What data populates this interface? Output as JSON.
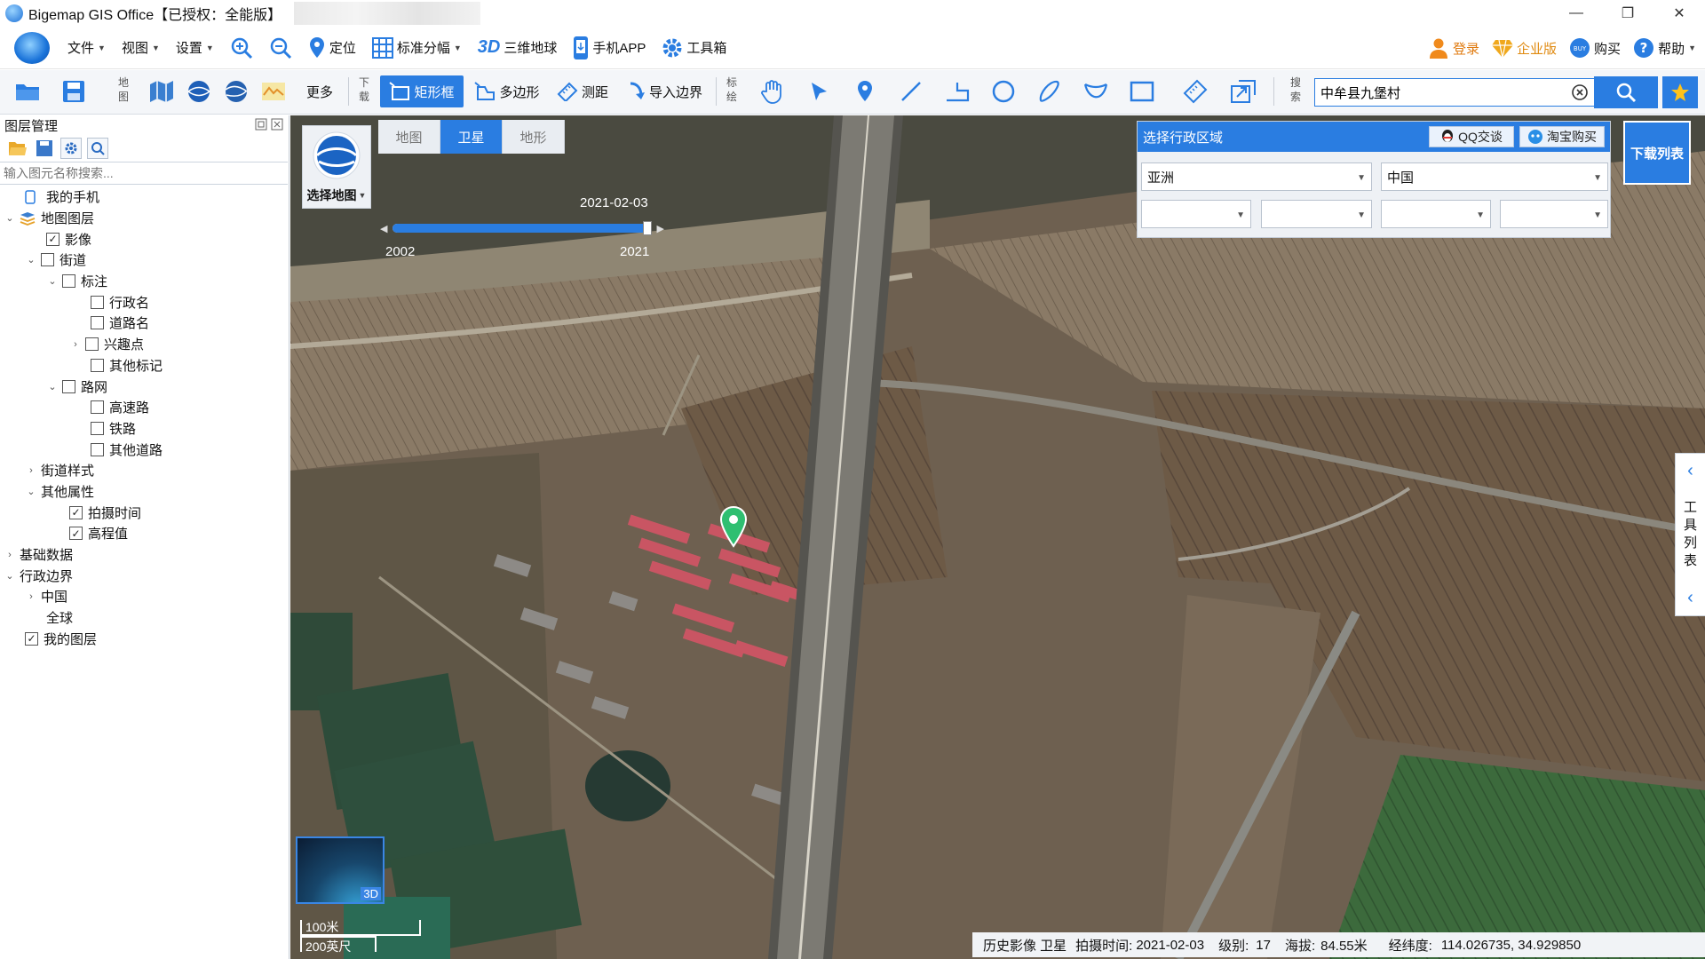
{
  "window": {
    "title": "Bigemap GIS Office【已授权：全能版】"
  },
  "menubar": {
    "file": "文件",
    "view": "视图",
    "settings": "设置",
    "locate": "定位",
    "standard_sheet": "标准分幅",
    "three_d_label": "3D",
    "globe": "三维地球",
    "mobile_app": "手机APP",
    "toolbox": "工具箱",
    "login": "登录",
    "enterprise": "企业版",
    "buy": "购买",
    "help": "帮助"
  },
  "toolbar": {
    "map_label": "地图",
    "more": "更多",
    "download_label": "下载",
    "rect_select": "矩形框",
    "polygon": "多边形",
    "measure": "测距",
    "import_boundary": "导入边界",
    "draw_label": "标绘",
    "search_label": "搜索"
  },
  "search": {
    "value": "中牟县九堡村"
  },
  "layer_panel": {
    "title": "图层管理",
    "search_placeholder": "输入图元名称搜索...",
    "tree": [
      {
        "label": "我的手机"
      },
      {
        "label": "地图图层"
      },
      {
        "label": "影像",
        "checked": true
      },
      {
        "label": "街道",
        "checked": false
      },
      {
        "label": "标注",
        "checked": false
      },
      {
        "label": "行政名",
        "checked": false
      },
      {
        "label": "道路名",
        "checked": false
      },
      {
        "label": "兴趣点",
        "checked": false
      },
      {
        "label": "其他标记",
        "checked": false
      },
      {
        "label": "路网",
        "checked": false
      },
      {
        "label": "高速路",
        "checked": false
      },
      {
        "label": "铁路",
        "checked": false
      },
      {
        "label": "其他道路",
        "checked": false
      },
      {
        "label": "街道样式"
      },
      {
        "label": "其他属性"
      },
      {
        "label": "拍摄时间",
        "checked": true
      },
      {
        "label": "高程值",
        "checked": true
      },
      {
        "label": "基础数据"
      },
      {
        "label": "行政边界"
      },
      {
        "label": "中国"
      },
      {
        "label": "全球"
      },
      {
        "label": "我的图层",
        "checked": true
      }
    ]
  },
  "map": {
    "types": [
      "地图",
      "卫星",
      "地形"
    ],
    "active_type": "卫星",
    "select_map": "选择地图",
    "timeline": {
      "current_date": "2021-02-03",
      "start_year": "2002",
      "end_year": "2021"
    },
    "minimap_label": "3D",
    "scale": {
      "metric": "100米",
      "imperial": "200英尺"
    }
  },
  "region": {
    "title": "选择行政区域",
    "qq_chat": "QQ交谈",
    "taobao_buy": "淘宝购买",
    "continent": "亚洲",
    "country": "中国",
    "download_list": "下载列表"
  },
  "side_toolbar": {
    "label": "工具列表"
  },
  "status": {
    "source": "历史影像 卫星",
    "capture_label": "拍摄时间:",
    "capture_date": "2021-02-03",
    "level_label": "级别:",
    "level": "17",
    "altitude_label": "海拔:",
    "altitude": "84.55米",
    "coord_label": "经纬度:",
    "coords": "114.026735, 34.929850"
  },
  "colors": {
    "accent": "#2a7de1",
    "marker": "#2fbf71"
  }
}
